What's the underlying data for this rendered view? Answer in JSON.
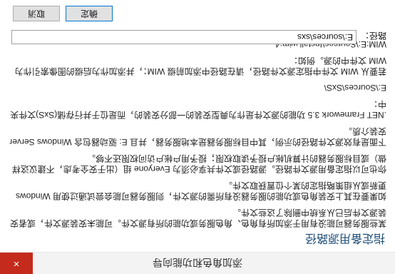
{
  "window": {
    "title": "添加角色和功能向导",
    "close_glyph": "×"
  },
  "heading": "指定备用源路径",
  "paragraphs": [
    "某些服务器可能没有用于添加所有角色、角色服务或功能的所有源文件。可能未安装源文件，或者安装源文件后已从系统中删除了这些文件。",
    "如果要在其上安装角色或功能的服务器没有所需的源文件，则服务器可能会尝试通过使用 Windows 更新或从组策略指定的某个位置获取文件。",
    "你也可以指定备用源文件路径。源路径或文件共享必须为 Everyone 组（出于安全考虑，不建议这样做）或目标服务器的计算机帐户授予读取权限；授予用户帐户访问权限还不够。",
    "下面是有效源文件路径的示例，其中目标服务器是本地服务器，并且 E: 驱动器包含 Windows Server 安装介质。",
    ".NET Framework 3.5 功能的源文件是作为典型安装的一部分安装的，而是位于并行存储(SxS)文件夹中：",
    "E:\\Sources\\SxS\\",
    "若要从 WIM 文件中指定源文件路径，请在路径中添加前缀 WIM：，并添加作为后缀的图像索引作为 WIM 文件中的源。例如：",
    "WIM:E:\\Sources\\Install.wim:4"
  ],
  "path_field": {
    "label": "路径：",
    "value": "E:\\sources\\sxs"
  },
  "buttons": {
    "ok": "确定",
    "cancel": "取消"
  }
}
